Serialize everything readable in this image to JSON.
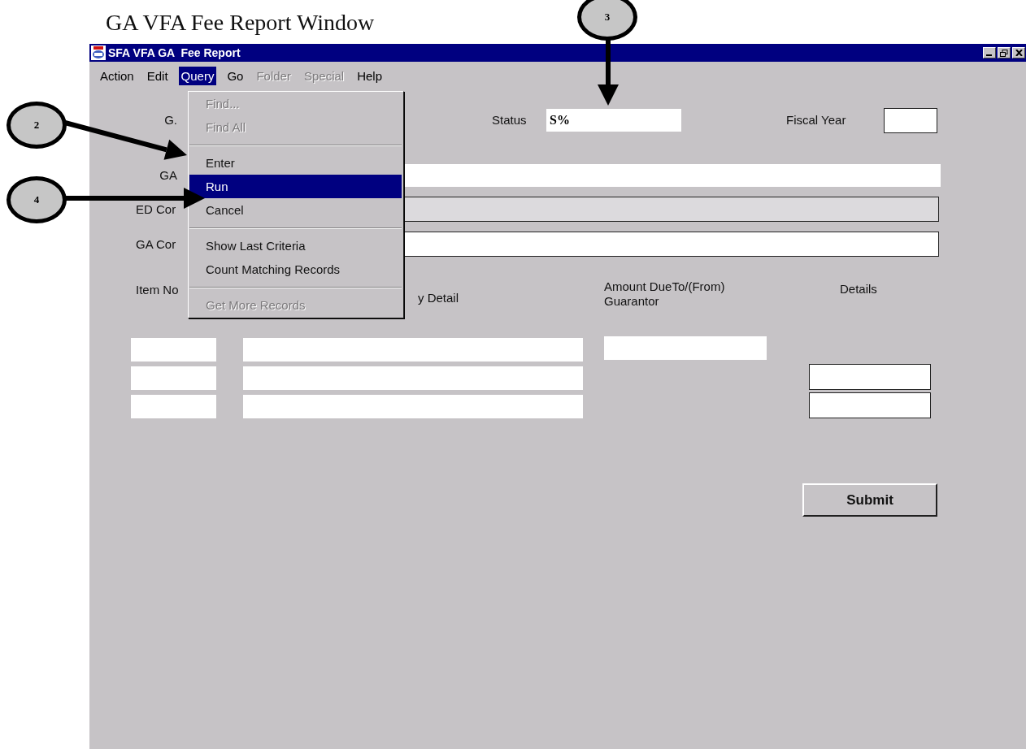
{
  "document_title": "GA VFA Fee Report Window",
  "window": {
    "title": "SFA VFA GA  Fee Report"
  },
  "menu_bar": [
    {
      "label": "Action",
      "disabled": false,
      "selected": false
    },
    {
      "label": "Edit",
      "disabled": false,
      "selected": false
    },
    {
      "label": "Query",
      "disabled": false,
      "selected": true
    },
    {
      "label": "Go",
      "disabled": false,
      "selected": false
    },
    {
      "label": "Folder",
      "disabled": true,
      "selected": false
    },
    {
      "label": "Special",
      "disabled": true,
      "selected": false
    },
    {
      "label": "Help",
      "disabled": false,
      "selected": false
    }
  ],
  "query_menu": [
    {
      "kind": "item",
      "label": "Find...",
      "disabled": true,
      "selected": false
    },
    {
      "kind": "item",
      "label": "Find All",
      "disabled": true,
      "selected": false
    },
    {
      "kind": "separator"
    },
    {
      "kind": "item",
      "label": "Enter",
      "disabled": false,
      "selected": false
    },
    {
      "kind": "item",
      "label": "Run",
      "disabled": false,
      "selected": true
    },
    {
      "kind": "item",
      "label": "Cancel",
      "disabled": false,
      "selected": false
    },
    {
      "kind": "separator"
    },
    {
      "kind": "item",
      "label": "Show Last Criteria",
      "disabled": false,
      "selected": false
    },
    {
      "kind": "item",
      "label": "Count Matching Records",
      "disabled": false,
      "selected": false
    },
    {
      "kind": "separator"
    },
    {
      "kind": "item",
      "label": "Get More Records",
      "disabled": true,
      "selected": false
    }
  ],
  "form": {
    "top_label": "G.",
    "status_label": "Status",
    "status_value": "S%",
    "fiscal_year_label": "Fiscal Year",
    "fields": [
      {
        "label": "GA",
        "kind": "plain"
      },
      {
        "label": "ED Cor",
        "kind": "readonly"
      },
      {
        "label": "GA Cor",
        "kind": "boxed"
      }
    ]
  },
  "table": {
    "columns": [
      "Item No",
      "y Detail",
      "Amount DueTo/(From)\nGuarantor",
      "Details"
    ]
  },
  "submit_button": "Submit",
  "callouts": [
    {
      "number": "3"
    },
    {
      "number": "2"
    },
    {
      "number": "4"
    }
  ]
}
